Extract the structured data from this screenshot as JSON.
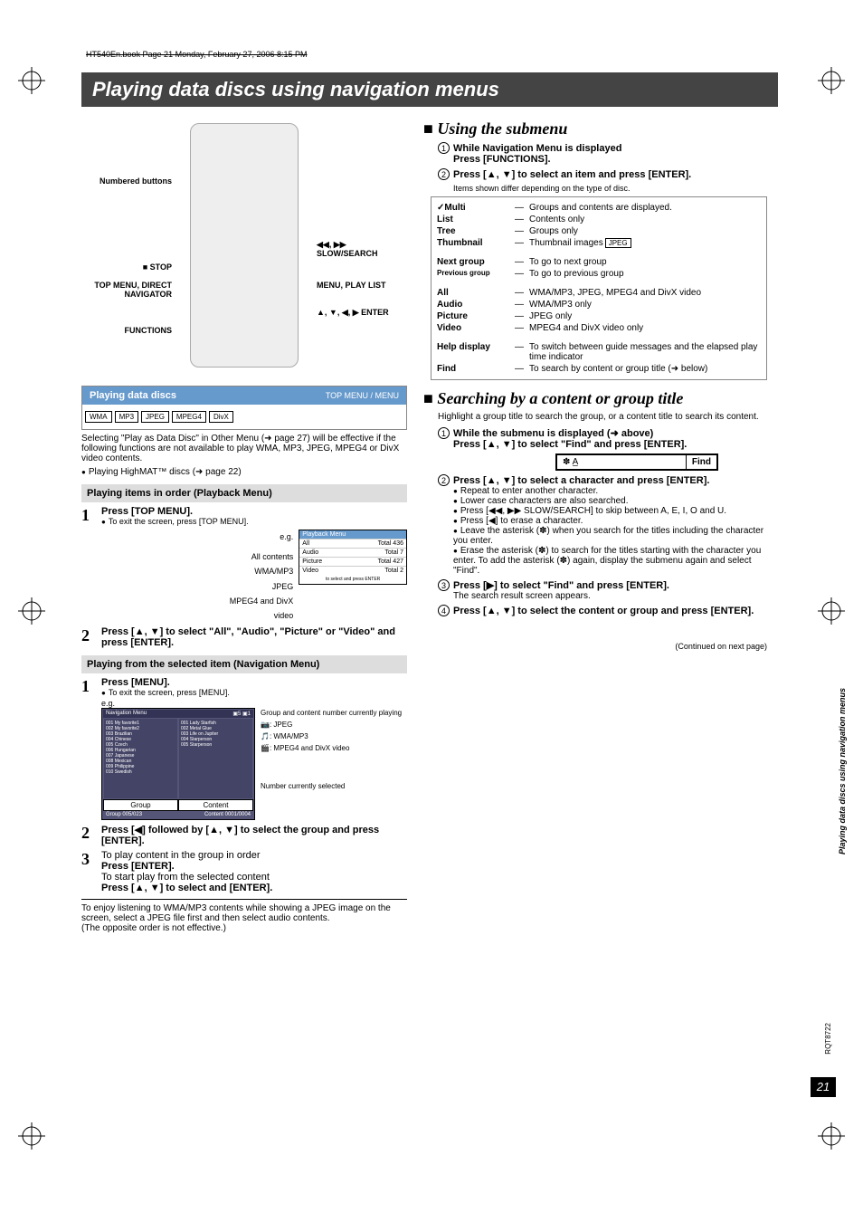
{
  "crop_header": "HT540En.book  Page 21  Monday, February 27, 2006  8:15 PM",
  "banner": "Playing data discs using navigation menus",
  "remote_labels": {
    "numbered": "Numbered buttons",
    "stop": "■ STOP",
    "topmenu": "TOP MENU, DIRECT NAVIGATOR",
    "functions": "FUNCTIONS",
    "slow": "◀◀, ▶▶ SLOW/SEARCH",
    "menu": "MENU, PLAY LIST",
    "enter": "▲, ▼, ◀, ▶ ENTER"
  },
  "box1": {
    "title": "Playing data discs",
    "right": "TOP MENU / MENU",
    "chips": [
      "WMA",
      "MP3",
      "JPEG",
      "MPEG4",
      "DivX"
    ]
  },
  "intro": "Selecting \"Play as Data Disc\" in Other Menu (➜ page 27) will be effective if the following functions are not available to play WMA, MP3, JPEG, MPEG4 or DivX video contents.",
  "intro_bullet": "Playing HighMAT™ discs (➜ page 22)",
  "subhead1": "Playing items in order (Playback Menu)",
  "step1_1": "Press [TOP MENU].",
  "step1_1_note": "To exit the screen, press [TOP MENU].",
  "eg": "e.g.",
  "pb_menu": {
    "head": "Playback Menu",
    "rows": [
      {
        "l": "All",
        "r": "Total 436"
      },
      {
        "l": "Audio",
        "r": "Total 7"
      },
      {
        "l": "Picture",
        "r": "Total 427"
      },
      {
        "l": "Video",
        "r": "Total 2"
      }
    ],
    "foot": "to select and press ENTER"
  },
  "pb_labels": [
    "All contents",
    "WMA/MP3",
    "JPEG",
    "MPEG4 and DivX video"
  ],
  "step1_2": "Press [▲, ▼] to select \"All\", \"Audio\", \"Picture\" or \"Video\" and press [ENTER].",
  "subhead2": "Playing from the selected item (Navigation Menu)",
  "step2_1": "Press [MENU].",
  "step2_1_note": "To exit the screen, press [MENU].",
  "nav_menu": {
    "head": "Navigation  Menu",
    "group_btn": "Group",
    "content_btn": "Content",
    "status_l": "Group  005/023",
    "status_r": "Content  0001/0004",
    "left_items": [
      "001 My favorite1",
      "002 My favorite2",
      "  003 Brazilian",
      "  004 Chinese",
      "  005 Czech",
      "  006 Hungarian",
      "  007 Japanese",
      "  008 Mexican",
      "  009 Philippine",
      "  010 Swedish"
    ],
    "right_items": [
      "001 Lady Starfish",
      "002 Metal Glue",
      "003 Life on Jupiter",
      "004 Starperson",
      "005 Starperson"
    ]
  },
  "nav_callouts": {
    "top": "Group and content number currently playing",
    "jpeg": ": JPEG",
    "wma": ": WMA/MP3",
    "mp4": ": MPEG4 and DivX video",
    "bottom": "Number currently selected"
  },
  "step2_2": "Press [◀] followed by [▲, ▼] to select the group and press [ENTER].",
  "step2_3a": "To play content in the group in order",
  "step2_3b": "Press [ENTER].",
  "step2_3c": "To start play from the selected content",
  "step2_3d": "Press [▲, ▼] to select and [ENTER].",
  "note": "To enjoy listening to WMA/MP3 contents while showing a JPEG image on the screen, select a JPEG file first and then select audio contents.\n(The opposite order is not effective.)",
  "using_submenu": {
    "title": "Using the submenu",
    "s1": "While Navigation Menu is displayed",
    "s1b": "Press [FUNCTIONS].",
    "s2": "Press [▲, ▼] to select an item and press [ENTER].",
    "note": "Items shown differ depending on the type of disc."
  },
  "submenu_items": [
    {
      "k": "✓Multi",
      "v": "Groups and contents are displayed."
    },
    {
      "k": "List",
      "v": "Contents only"
    },
    {
      "k": "Tree",
      "v": "Groups only"
    },
    {
      "k": "Thumbnail",
      "v": "Thumbnail images",
      "chip": "JPEG"
    },
    {
      "k": "",
      "v": ""
    },
    {
      "k": "Next group",
      "v": "To go to next group"
    },
    {
      "k": "Previous group",
      "v": "To go to previous group"
    },
    {
      "k": "",
      "v": ""
    },
    {
      "k": "All",
      "v": "WMA/MP3, JPEG, MPEG4 and DivX video"
    },
    {
      "k": "Audio",
      "v": "WMA/MP3 only"
    },
    {
      "k": "Picture",
      "v": "JPEG only"
    },
    {
      "k": "Video",
      "v": "MPEG4 and DivX video only"
    },
    {
      "k": "",
      "v": ""
    },
    {
      "k": "Help display",
      "v": "To switch between guide messages and the elapsed play time indicator"
    },
    {
      "k": "Find",
      "v": "To search by content or group title (➜ below)"
    }
  ],
  "search": {
    "title": "Searching by a content or group title",
    "lead": "Highlight a group title to search the group, or a content title to search its content.",
    "s1a": "While the submenu is displayed (➜ above)",
    "s1b": "Press [▲, ▼] to select \"Find\" and press [ENTER].",
    "find_left": "✽ A̲",
    "find_right": "Find",
    "s2": "Press [▲, ▼] to select a character and press [ENTER].",
    "b1": "Repeat to enter another character.",
    "b2": "Lower case characters are also searched.",
    "b3": "Press [◀◀, ▶▶ SLOW/SEARCH] to skip between A, E, I, O and U.",
    "b4": "Press [◀] to erase a character.",
    "b5": "Leave the asterisk (✽) when you search for the titles including the character you enter.",
    "b6": "Erase the asterisk (✽) to search for the titles starting with the character you enter. To add the asterisk (✽) again, display the submenu again and select \"Find\".",
    "s3": "Press [▶] to select \"Find\" and press [ENTER].",
    "s3n": "The search result screen appears.",
    "s4": "Press [▲, ▼] to select the content or group and press [ENTER]."
  },
  "continued": "(Continued on next page)",
  "side_text": "Playing data discs using navigation menus",
  "rqt": "RQT8722",
  "pagenum": "21"
}
